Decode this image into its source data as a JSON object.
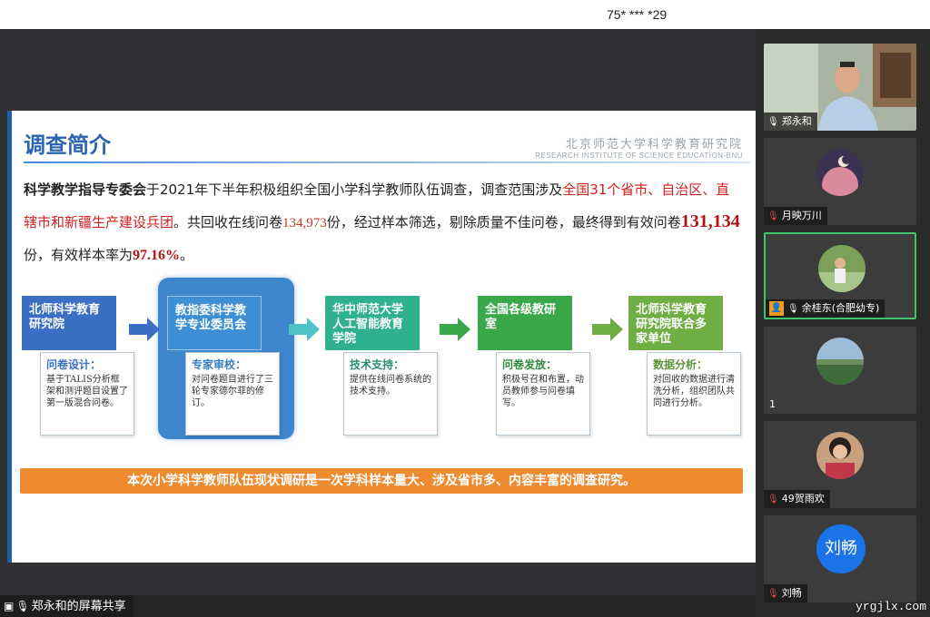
{
  "meeting": {
    "id_text": "75* *** *29"
  },
  "slide": {
    "title": "调查简介",
    "institute_cn": "北京师范大学科学教育研究院",
    "institute_en": "RESEARCH INSTITUTE OF SCIENCE EDUCATION-BNU",
    "intro": {
      "p1_bold": "科学教学指导专委会",
      "p1_text": "于2021年下半年积极组织全国小学科学教师队伍调查，调查范围涉及",
      "p1_red": "全国31个省市、自治区、直辖市和新疆生产建设兵团",
      "p1_text2": "。共回收在线问卷",
      "p1_num": "134,973",
      "p1_text3": "份，经过样本筛选，剔除质量不佳问卷，最终得到有效问卷",
      "p1_big": "131,134",
      "p1_text4": "份，有效样本率为",
      "p1_rate": "97.16%",
      "p1_end": "。"
    },
    "stages": [
      {
        "head": "北师科学教育研究院",
        "card_title": "问卷设计：",
        "card_text": "基于TALIS分析框架和测评题目设置了第一版混合问卷。"
      },
      {
        "head": "教指委科学教学专业委员会",
        "card_title": "专家审校：",
        "card_text": "对问卷题目进行了三轮专家德尔菲的修订。"
      },
      {
        "head": "华中师范大学人工智能教育学院",
        "card_title": "技术支持：",
        "card_text": "提供在线问卷系统的技术支持。"
      },
      {
        "head": "全国各级教研室",
        "card_title": "问卷发放：",
        "card_text": "积极号召和布置，动员教师参与问卷填写。"
      },
      {
        "head": "北师科学教育研究院联合多家单位",
        "card_title": "数据分析：",
        "card_text": "对回收的数据进行清洗分析，组织团队共同进行分析。"
      }
    ],
    "banner": "本次小学科学教师队伍现状调研是一次学科样本量大、涉及省市多、内容丰富的调查研究。"
  },
  "share_label": "郑永和的屏幕共享",
  "participants": [
    {
      "name": "郑永和",
      "muted": false
    },
    {
      "name": "月映万川",
      "muted": true
    },
    {
      "name": "余桂东(合肥幼专)",
      "muted": false,
      "host": true
    },
    {
      "name": "",
      "count": "1"
    },
    {
      "name": "49贺雨欢",
      "muted": true
    },
    {
      "name": "刘畅",
      "muted": true,
      "avatar_text": "刘畅"
    }
  ],
  "watermark": "yrgjlx.com",
  "colors": {
    "accent": "#2a64b0",
    "banner": "#ee8a2f",
    "active_border": "#3cc46a"
  }
}
